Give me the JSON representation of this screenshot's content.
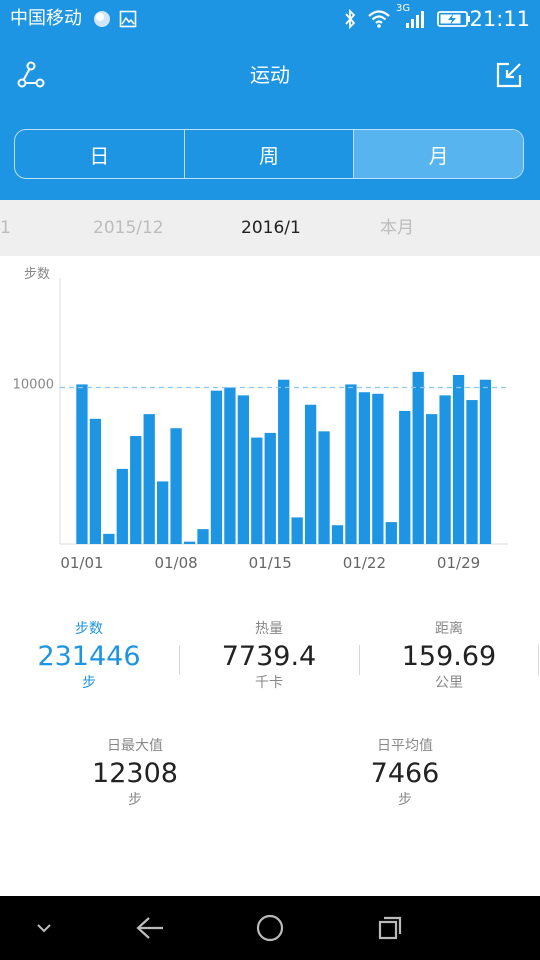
{
  "status_bar": {
    "carrier": "中国移动",
    "network_type": "3G",
    "time": "21:11",
    "icons": [
      "weather-icon",
      "image-notification-icon",
      "bluetooth-icon",
      "wifi-icon",
      "signal-icon",
      "battery-charging-icon"
    ]
  },
  "header": {
    "title": "运动",
    "left_icon": "share-icon",
    "right_icon": "exit-icon",
    "tabs": [
      {
        "label": "日",
        "active": false
      },
      {
        "label": "周",
        "active": false
      },
      {
        "label": "月",
        "active": true
      }
    ]
  },
  "month_nav": {
    "partial_left": "1",
    "previous": "2015/12",
    "current": "2016/1",
    "next": "本月"
  },
  "chart_data": {
    "type": "bar",
    "ylabel": "步数",
    "yticks": [
      10000
    ],
    "ylim": [
      0,
      17000
    ],
    "reference_line": {
      "value": 10000,
      "style": "dashed"
    },
    "xtick_labels": [
      {
        "label": "01/01",
        "day": 1
      },
      {
        "label": "01/08",
        "day": 8
      },
      {
        "label": "01/15",
        "day": 15
      },
      {
        "label": "01/22",
        "day": 22
      },
      {
        "label": "01/29",
        "day": 29
      }
    ],
    "categories": [
      "01/01",
      "01/02",
      "01/03",
      "01/04",
      "01/05",
      "01/06",
      "01/07",
      "01/08",
      "01/09",
      "01/10",
      "01/11",
      "01/12",
      "01/13",
      "01/14",
      "01/15",
      "01/16",
      "01/17",
      "01/18",
      "01/19",
      "01/20",
      "01/21",
      "01/22",
      "01/23",
      "01/24",
      "01/25",
      "01/26",
      "01/27",
      "01/28",
      "01/29",
      "01/30",
      "01/31"
    ],
    "values": [
      10200,
      8000,
      650,
      4800,
      6900,
      8300,
      4000,
      7400,
      150,
      950,
      9800,
      10000,
      9500,
      6800,
      7100,
      10500,
      1700,
      8900,
      7200,
      1200,
      10200,
      9700,
      9600,
      1400,
      8500,
      11000,
      8300,
      9500,
      10800,
      9200,
      10500
    ],
    "color": "#1e95e2",
    "grid": false,
    "legend": "none"
  },
  "stats": {
    "steps": {
      "label": "步数",
      "value": "231446",
      "unit": "步"
    },
    "calories": {
      "label": "热量",
      "value": "7739.4",
      "unit": "千卡"
    },
    "distance": {
      "label": "距离",
      "value": "159.69",
      "unit": "公里"
    },
    "daily_max": {
      "label": "日最大值",
      "value": "12308",
      "unit": "步"
    },
    "daily_avg": {
      "label": "日平均值",
      "value": "7466",
      "unit": "步"
    }
  },
  "nav_bar": {
    "buttons": [
      "collapse-icon",
      "back-icon",
      "home-icon",
      "recents-icon"
    ]
  },
  "colors": {
    "accent": "#1e95e2",
    "tab_active": "#58b4ee",
    "month_bar_bg": "#efefef",
    "muted_text": "#888888"
  }
}
